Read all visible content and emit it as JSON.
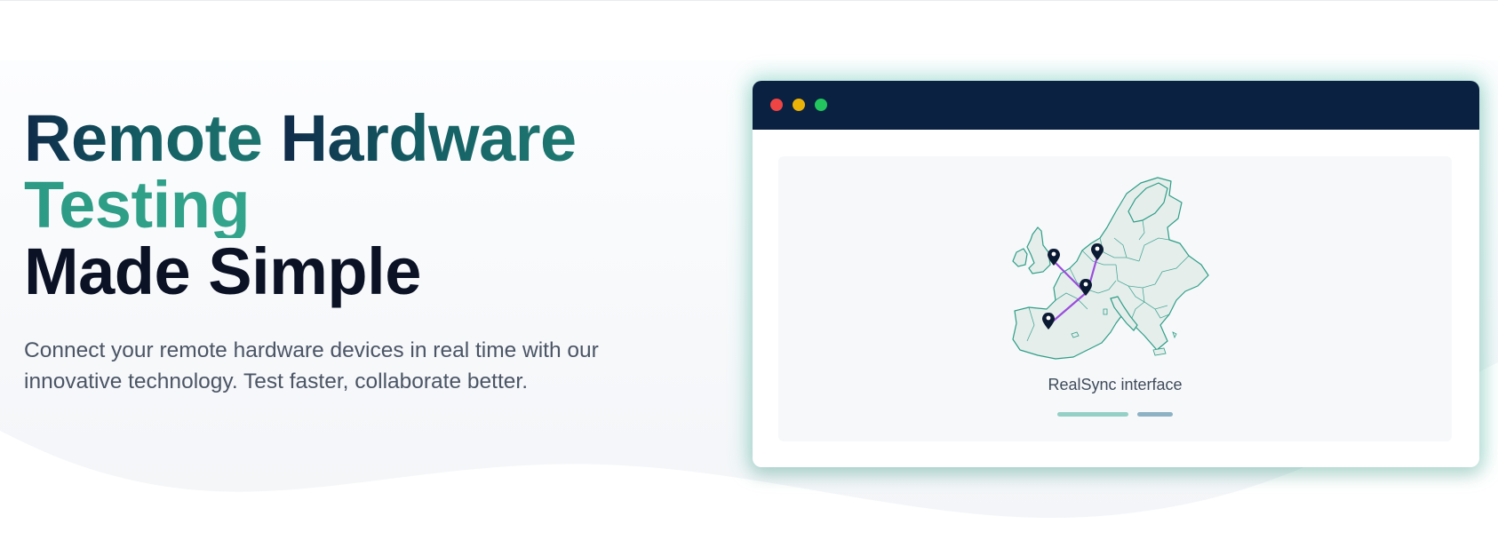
{
  "hero": {
    "title_part1": "Remote ",
    "title_part2": "Hardware",
    "title_line2": "Testing",
    "title_line3": "Made Simple",
    "subtitle": "Connect your remote hardware devices in real time with our innovative technology. Test faster, collaborate better."
  },
  "preview": {
    "caption": "RealSync interface",
    "window_controls": [
      "close-dot",
      "minimize-dot",
      "maximize-dot"
    ],
    "map_icons": [
      "location-pin-icon",
      "location-pin-icon",
      "location-pin-icon",
      "location-pin-icon"
    ]
  },
  "colors": {
    "titlebar": "#0b2142",
    "accent_teal": "#3db59a",
    "route_purple": "#9b4ddb",
    "pin_dark": "#0b1a33"
  }
}
